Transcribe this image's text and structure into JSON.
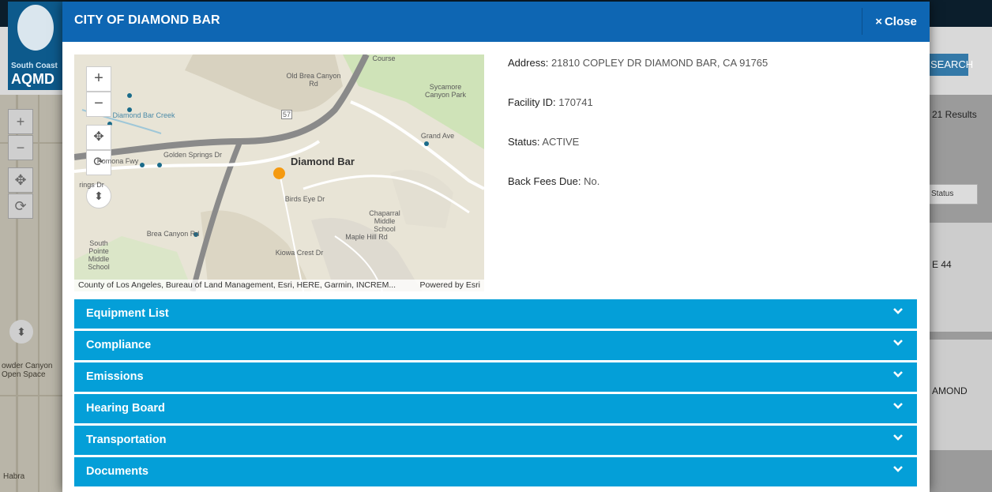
{
  "background": {
    "logo": {
      "line1": "South Coast",
      "line2": "AQMD"
    },
    "search_label": "SEARCH",
    "results_text": "21 Results",
    "status_select": "Status",
    "card_texts": [
      "E 44",
      "AMOND"
    ],
    "map_labels": [
      "owder Canyon",
      "Open Space",
      "Habra"
    ],
    "map_tools": [
      "+",
      "−",
      "✥",
      "⟳"
    ],
    "compass": "⬍"
  },
  "modal": {
    "title": "CITY OF DIAMOND BAR",
    "close_label": "Close",
    "close_icon": "×"
  },
  "map": {
    "tools": {
      "zoom_in": "+",
      "zoom_out": "−",
      "pan": "✥",
      "rotate": "⟳",
      "compass": "⬍"
    },
    "labels": {
      "town": "Diamond Bar",
      "sycamore": "Sycamore Canyon Park",
      "chaparral": "Chaparral Middle School",
      "south_pointe": "South Pointe Middle School",
      "diamond_bar_creek": "Diamond Bar Creek",
      "pomona_fwy": "Pomona Fwy",
      "golden_springs": "Golden Springs Dr",
      "old_brea": "Old Brea Canyon Rd",
      "brea_canyon": "Brea Canyon Rd",
      "birds_eye": "Birds Eye Dr",
      "maple_hill": "Maple Hill Rd",
      "kiowa": "Kiowa Crest Dr",
      "grand_ave": "Grand Ave",
      "course": "Course",
      "springs_dr": "rings Dr",
      "hwy": "57"
    },
    "attribution": "County of Los Angeles, Bureau of Land Management, Esri, HERE, Garmin, INCREM...",
    "powered_by": "Powered by Esri",
    "marker_color": "#f59a10"
  },
  "details": {
    "address_label": "Address:",
    "address_value": "21810 COPLEY DR DIAMOND BAR, CA 91765",
    "facility_label": "Facility ID:",
    "facility_value": "170741",
    "status_label": "Status:",
    "status_value": "ACTIVE",
    "fees_label": "Back Fees Due:",
    "fees_value": "No."
  },
  "accordion": [
    {
      "label": "Equipment List"
    },
    {
      "label": "Compliance"
    },
    {
      "label": "Emissions"
    },
    {
      "label": "Hearing Board"
    },
    {
      "label": "Transportation"
    },
    {
      "label": "Documents"
    }
  ],
  "colors": {
    "header_blue": "#0e66b3",
    "accordion_blue": "#049fd8"
  }
}
